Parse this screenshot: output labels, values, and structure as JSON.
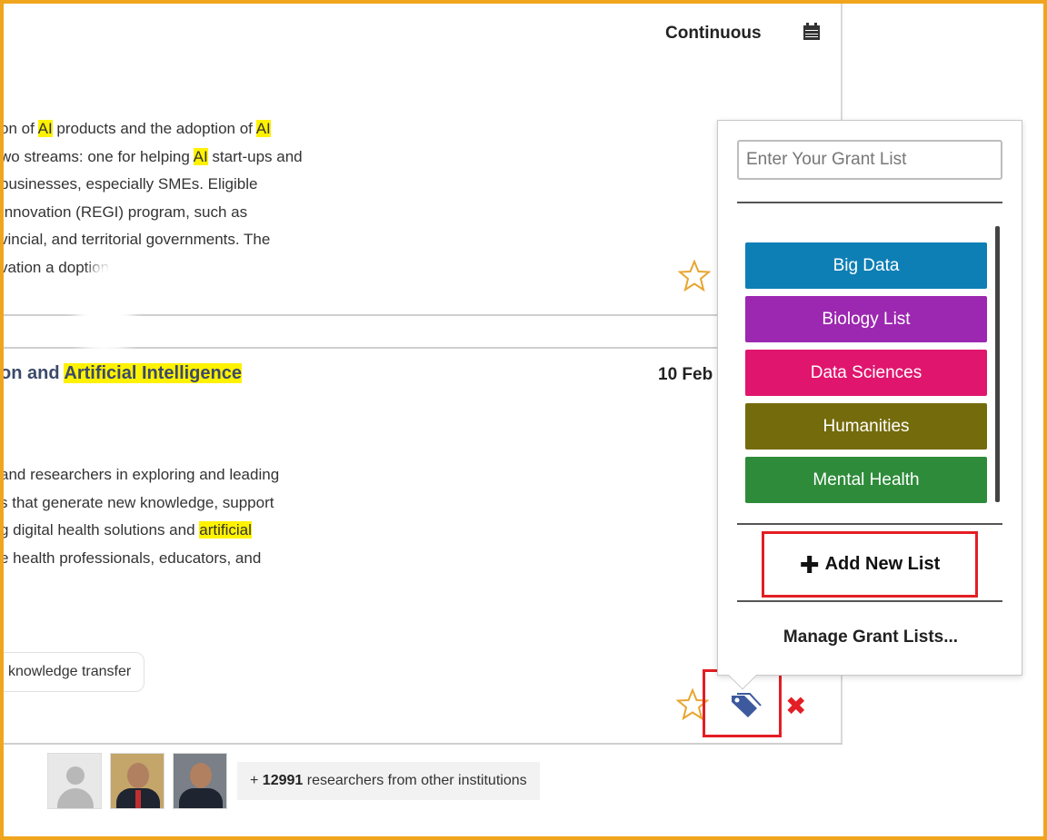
{
  "grant1": {
    "deadline": "Continuous",
    "abstract_lines": [
      [
        {
          "t": "on of "
        },
        {
          "t": "AI",
          "hl": true
        },
        {
          "t": " products and the adoption of "
        },
        {
          "t": "AI",
          "hl": true
        }
      ],
      [
        {
          "t": "wo streams: one for helping "
        },
        {
          "t": "AI",
          "hl": true
        },
        {
          "t": " start-ups and"
        }
      ],
      [
        {
          "t": " businesses, especially SMEs. Eligible"
        }
      ],
      [
        {
          "t": " Innovation (REGI) program, such as"
        }
      ],
      [
        {
          "t": "vincial, and territorial governments. The"
        }
      ],
      [
        {
          "t": "vation a"
        },
        {
          "t": "     "
        },
        {
          "t": "doption."
        }
      ]
    ]
  },
  "grant2": {
    "title_parts": [
      {
        "t": "on and "
      },
      {
        "t": "Artificial Intelligence",
        "hl": true
      }
    ],
    "deadline": "10 Feb",
    "abstract_lines": [
      [
        {
          "t": " and researchers in exploring and leading"
        }
      ],
      [
        {
          "t": "s that generate new knowledge, support"
        }
      ],
      [
        {
          "t": "g digital health solutions and "
        },
        {
          "t": "artificial",
          "hl": true
        }
      ],
      [
        {
          "t": "e health professionals, educators, and"
        }
      ]
    ],
    "tag": "knowledge transfer"
  },
  "researchers": {
    "count": "12991",
    "prefix": "+ ",
    "suffix": " researchers from other institutions"
  },
  "grant_list_popover": {
    "input_placeholder": "Enter Your Grant List",
    "lists": [
      {
        "label": "Big Data",
        "color": "#0e7fb5"
      },
      {
        "label": "Biology List",
        "color": "#9c27b0"
      },
      {
        "label": "Data Sciences",
        "color": "#e0156e"
      },
      {
        "label": "Humanities",
        "color": "#746b0c"
      },
      {
        "label": "Mental Health",
        "color": "#2e8b3a"
      }
    ],
    "add_new_label": "Add New List",
    "manage_label": "Manage Grant Lists..."
  },
  "colors": {
    "highlight": "#fff200",
    "accent_red": "#e31e24",
    "frame": "#f0a51e",
    "star": "#e8a530",
    "tag_icon": "#3d5a9e"
  },
  "icons": [
    "calendar-icon",
    "star-icon",
    "tag-icon",
    "remove-icon",
    "plus-icon",
    "user-placeholder-icon"
  ]
}
